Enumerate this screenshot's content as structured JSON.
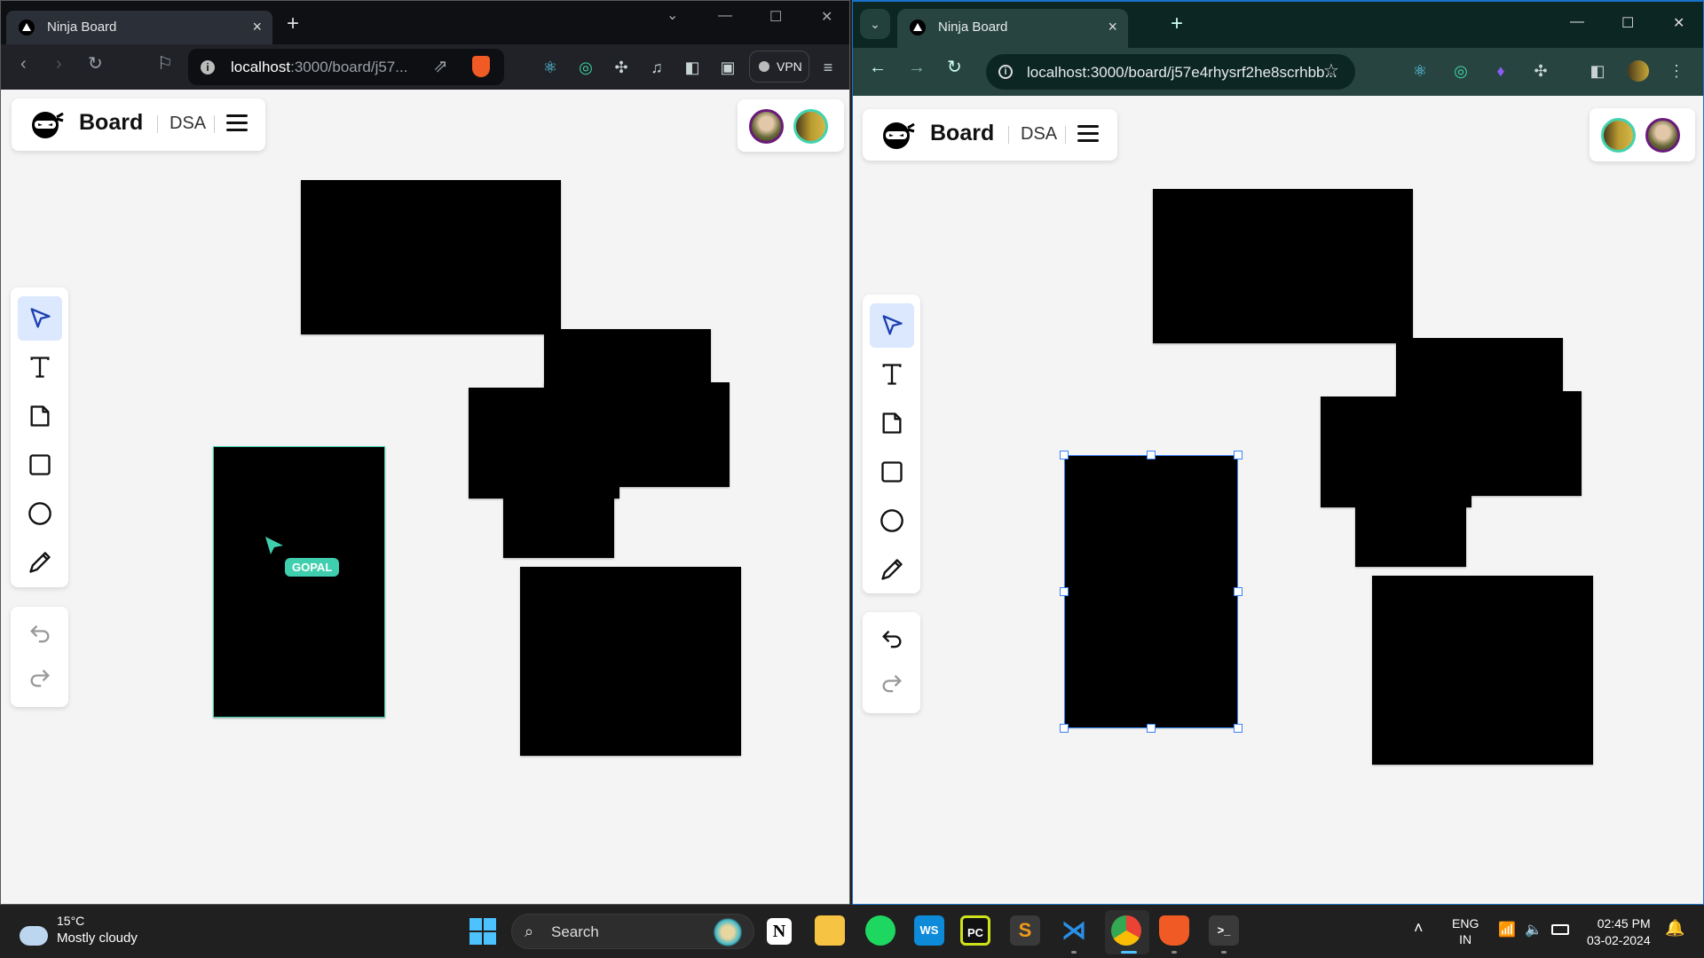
{
  "left_window": {
    "browser": "Brave",
    "tab": {
      "title": "Ninja Board",
      "close": "×"
    },
    "new_tab": "+",
    "url": {
      "host": "localhost",
      "rest": ":3000/board/j57..."
    },
    "vpn_label": "VPN",
    "board": {
      "title": "Board",
      "name": "DSA"
    },
    "remote_cursor": {
      "user": "GOPAL",
      "color": "#40cfae"
    },
    "selected_shape_outline_color": "#40cfae"
  },
  "right_window": {
    "browser": "Chrome",
    "tab": {
      "title": "Ninja Board",
      "close": "×"
    },
    "new_tab": "+",
    "url": {
      "text": "localhost:3000/board/j57e4rhysrf2he8scrhbb..."
    },
    "board": {
      "title": "Board",
      "name": "DSA"
    },
    "selection_color": "#3b82f6"
  },
  "toolbar": {
    "tools": [
      {
        "name": "select",
        "icon": "pointer-icon",
        "active": true
      },
      {
        "name": "text",
        "icon": "text-icon",
        "active": false
      },
      {
        "name": "sticky-note",
        "icon": "sticky-note-icon",
        "active": false
      },
      {
        "name": "rectangle",
        "icon": "rectangle-icon",
        "active": false
      },
      {
        "name": "ellipse",
        "icon": "ellipse-icon",
        "active": false
      },
      {
        "name": "pencil",
        "icon": "pencil-icon",
        "active": false
      }
    ],
    "undo": "undo-icon",
    "redo": "redo-icon"
  },
  "taskbar": {
    "weather": {
      "temp": "15°C",
      "condition": "Mostly cloudy"
    },
    "search_placeholder": "Search",
    "apps": [
      "Notion",
      "File Explorer",
      "Spotify",
      "WebStorm",
      "PyCharm",
      "Sublime Text",
      "VS Code",
      "Chrome",
      "Brave",
      "Terminal"
    ],
    "app_labels": {
      "notion": "N",
      "webstorm": "WS",
      "pycharm": "PC",
      "terminal": ">_"
    },
    "lang": {
      "line1": "ENG",
      "line2": "IN"
    },
    "time": "02:45 PM",
    "date": "03-02-2024"
  },
  "colors": {
    "canvas_bg": "#f4f4f4",
    "active_tool_bg": "#dbe8fd",
    "active_tool_icon": "#1e40af",
    "brave_bg": "#0f1014",
    "chrome_bg": "#0c2623"
  }
}
